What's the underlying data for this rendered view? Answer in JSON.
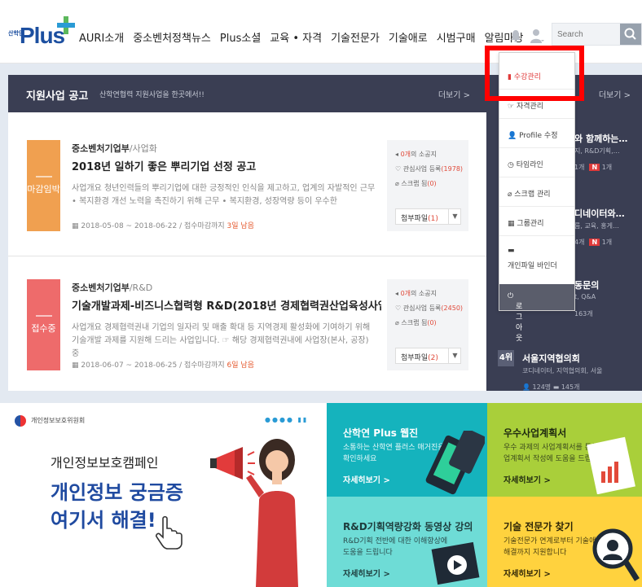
{
  "logo": {
    "small_text": "산학연",
    "name": "Plus"
  },
  "nav": {
    "items": [
      "AURI소개",
      "중소벤처정책뉴스",
      "Plus소셜",
      "교육 • 자격",
      "기술전문가",
      "기술애로",
      "시범구매",
      "알림마당"
    ]
  },
  "search": {
    "placeholder": "Search"
  },
  "support": {
    "title": "지원사업 공고",
    "subtitle": "산학연협력 지원사업을 한곳에서!!",
    "more": "더보기 >",
    "notices": [
      {
        "status": "마감임박",
        "status_color": "#f0a050",
        "org": "중소벤처기업부",
        "category": "/사업화",
        "title": "2018년 일하기 좋은 뿌리기업 선정 공고",
        "desc": "사업개요 청년인력들의 뿌리기업에 대한 긍정적인 인식을 제고하고, 업계의 자발적인 근무 • 복지환경 개선 노력을 촉진하기 위해 근무 • 복지환경, 성장역량 등이 우수한",
        "date": "2018-05-08 ~ 2018-06-22 / 접수마감까지 ",
        "remaining": "3일 남음",
        "reply_count": "0개",
        "reply_label": "의 소공지",
        "interest_label": "관심사업 등록",
        "interest_count": "(1978)",
        "scrap_label": "스크랩 됨",
        "scrap_count": "(0)",
        "attach_label": "첨부파일",
        "attach_count": "(1)"
      },
      {
        "status": "접수중",
        "status_color": "#ee6b6b",
        "org": "중소벤처기업부",
        "category": "/R&D",
        "title": "기술개발과제-비즈니스협력형 R&D(2018년 경제협력권산업육성사업…",
        "desc": "사업개요 경제협력권내 기업의 일자리 및 매출 확대 등 지역경제 활성화에 기여하기 위해 기술개발 과제를 지원해 드리는 사업입니다. ☞ 해당 경제협력권내에 사업장(본사, 공장) 중",
        "date": "2018-06-07 ~ 2018-06-25 / 접수마감까지 ",
        "remaining": "6일 남음",
        "reply_count": "0개",
        "reply_label": "의 소공지",
        "interest_label": "관심사업 등록",
        "interest_count": "(2450)",
        "scrap_label": "스크랩 됨",
        "scrap_count": "(0)",
        "attach_label": "첨부파일",
        "attach_count": "(2)"
      }
    ]
  },
  "ranking": {
    "more": "더보기 >",
    "items": [
      {
        "title": "와 함께하는…",
        "sub": "지, R&D기획,…",
        "stats": "1개",
        "new_badge": "N",
        "new_count": "1개"
      },
      {
        "title": "디네이터와…",
        "sub": "름, 교육, 홍게…",
        "stats": "4개",
        "new_badge": "N",
        "new_count": "1개"
      },
      {
        "title": "동문의",
        "sub": "t, Q&A",
        "stats": "163개"
      },
      {
        "rank": "4위",
        "title": "서울지역협의회",
        "sub": "코디네이터, 지역협의회, 서울",
        "members": "124명",
        "posts": "145개"
      }
    ]
  },
  "dropdown": {
    "items": [
      "수강관리",
      "자격관리",
      "Profile 수정",
      "타임라인",
      "스크랩 관리",
      "그룹관리",
      "개인파일 바인더"
    ],
    "logout": "로그아웃"
  },
  "banner": {
    "org": "개인정보보호위원회",
    "line1": "개인정보보호캠페인",
    "line2": "개인정보 궁금증",
    "line3": "여기서 해결!"
  },
  "tiles": [
    {
      "title": "산학연 Plus 웹진",
      "desc": "소통하는 산학연 플러스 매거진을 확인하세요",
      "link": "자세히보기 >"
    },
    {
      "title": "우수사업계획서",
      "desc": "우수 과제의 사업계획서를 통해 사업계획서 작성에 도움을 드립니다",
      "link": "자세히보기 >"
    },
    {
      "title": "R&D기획역량강화 동영상 강의",
      "desc": "R&D기획 전반에 대한 이해향상에 도움을 드립니다",
      "link": "자세히보기 >"
    },
    {
      "title": "기술 전문가 찾기",
      "desc": "기술전문가 연계로부터 기술애로 해결까지 지원합니다",
      "link": "자세히보기 >"
    }
  ]
}
